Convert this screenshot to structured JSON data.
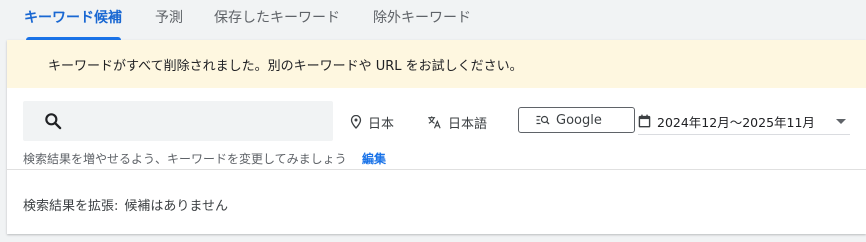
{
  "tabs": [
    {
      "label": "キーワード候補",
      "active": true
    },
    {
      "label": "予測",
      "active": false
    },
    {
      "label": "保存したキーワード",
      "active": false
    },
    {
      "label": "除外キーワード",
      "active": false
    }
  ],
  "banner": {
    "message": "キーワードがすべて削除されました。別のキーワードや URL をお試しください。"
  },
  "search": {
    "icon": "search-icon",
    "value": ""
  },
  "filters": {
    "location": {
      "label": "日本",
      "icon": "location-pin-icon"
    },
    "language": {
      "label": "日本語",
      "icon": "translate-icon"
    },
    "search_engine": {
      "label": "Google",
      "icon": "search-network-icon"
    },
    "date_range": {
      "label": "2024年12月～2025年11月",
      "icon": "calendar-icon"
    }
  },
  "hint": {
    "text": "検索結果を増やせるよう、キーワードを変更してみましょう",
    "edit_label": "編集"
  },
  "expand": {
    "label": "検索結果を拡張:",
    "value": "候補はありません"
  },
  "colors": {
    "accent": "#1a73e8",
    "banner_bg": "#fef7e0",
    "background": "#f1f3f4"
  }
}
